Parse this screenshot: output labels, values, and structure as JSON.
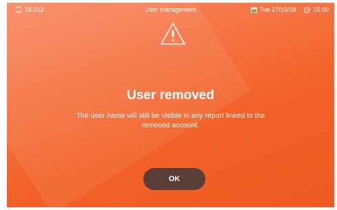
{
  "statusbar": {
    "sync_value": "16.012",
    "title": "User management",
    "date": "Tue 27/10/18",
    "time": "15:00"
  },
  "dialog": {
    "icon": "warning-triangle-icon",
    "title": "User removed",
    "message": "The user name will still be visible in any report linked to the removed account.",
    "ok_label": "OK"
  },
  "colors": {
    "background": "#f26128",
    "button": "#5a3e36",
    "text": "#ffffff"
  }
}
